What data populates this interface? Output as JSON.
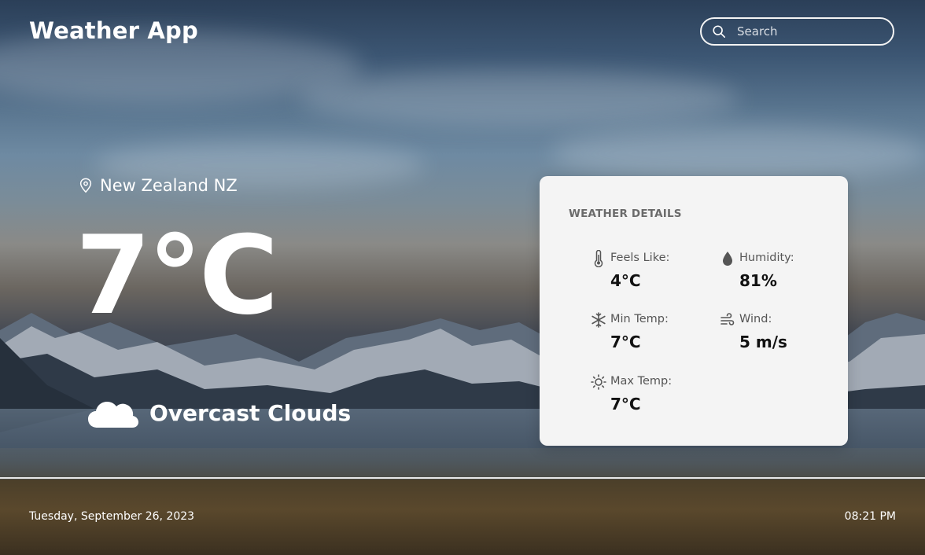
{
  "header": {
    "app_title": "Weather App",
    "search_placeholder": "Search",
    "search_value": ""
  },
  "current": {
    "location": "New Zealand NZ",
    "temperature": "7°C",
    "condition": "Overcast Clouds",
    "condition_icon": "cloud-icon"
  },
  "details": {
    "heading": "WEATHER DETAILS",
    "items": [
      {
        "icon": "thermometer-icon",
        "label": "Feels Like:",
        "value": "4°C"
      },
      {
        "icon": "droplet-icon",
        "label": "Humidity:",
        "value": "81%"
      },
      {
        "icon": "snowflake-icon",
        "label": "Min Temp:",
        "value": "7°C"
      },
      {
        "icon": "wind-icon",
        "label": "Wind:",
        "value": "5 m/s"
      },
      {
        "icon": "sun-icon",
        "label": "Max Temp:",
        "value": "7°C"
      }
    ]
  },
  "footer": {
    "date": "Tuesday, September 26, 2023",
    "time": "08:21 PM"
  },
  "colors": {
    "card_background": "#f4f4f4",
    "text_primary": "#ffffff",
    "detail_value": "#111111",
    "detail_label": "#555555"
  }
}
